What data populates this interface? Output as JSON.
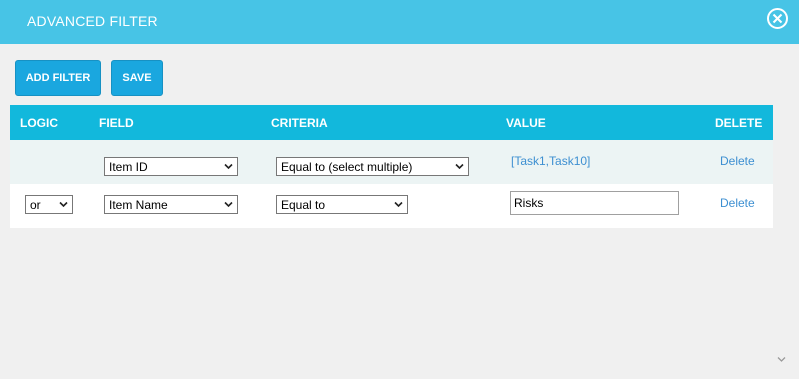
{
  "dialog": {
    "title": "ADVANCED FILTER"
  },
  "toolbar": {
    "add_filter_label": "ADD FILTER",
    "save_label": "SAVE"
  },
  "table": {
    "headers": {
      "logic": "LOGIC",
      "field": "FIELD",
      "criteria": "CRITERIA",
      "value": "VALUE",
      "delete": "DELETE"
    },
    "rows": [
      {
        "logic": "",
        "field": "Item ID",
        "criteria": "Equal to (select multiple)",
        "value": "[Task1,Task10]",
        "delete": "Delete"
      },
      {
        "logic": "or",
        "field": "Item Name",
        "criteria": "Equal to",
        "value": "Risks",
        "delete": "Delete"
      }
    ]
  },
  "colors": {
    "titlebar": "#47c4e6",
    "header": "#12b8dc",
    "button": "#1aa7df",
    "link": "#3d8fd1"
  }
}
